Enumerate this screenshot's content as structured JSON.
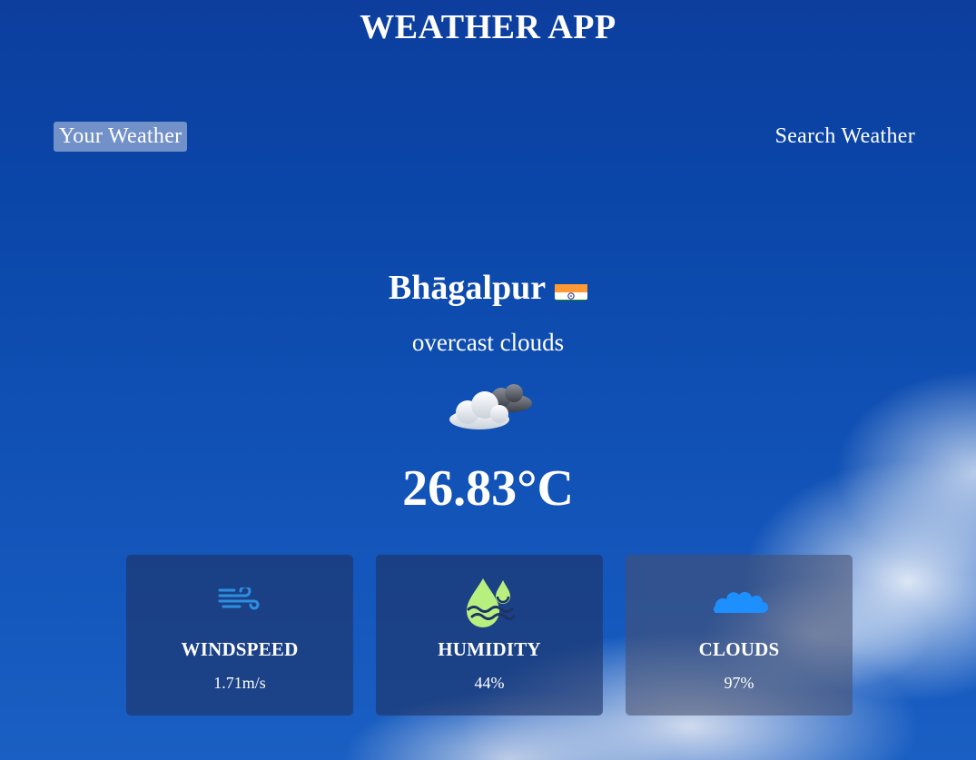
{
  "header": {
    "title": "WEATHER APP"
  },
  "tabs": [
    {
      "label": "Your Weather",
      "active": true
    },
    {
      "label": "Search Weather",
      "active": false
    }
  ],
  "weather": {
    "city": "Bhāgalpur",
    "country_flag_icon": "india-flag-icon",
    "description": "overcast clouds",
    "condition_icon": "overcast-clouds-icon",
    "temperature": "26.83°C"
  },
  "stats": [
    {
      "icon": "wind-icon",
      "label": "WINDSPEED",
      "value": "1.71m/s"
    },
    {
      "icon": "humidity-drops-icon",
      "label": "HUMIDITY",
      "value": "44%"
    },
    {
      "icon": "cloud-icon",
      "label": "CLOUDS",
      "value": "97%"
    }
  ],
  "colors": {
    "sky_blue": "#0a46a8",
    "card_bg": "#1e3264",
    "wind_icon": "#2e8fe0",
    "humidity_icon": "#b8f080",
    "cloud_icon": "#1e8fff"
  }
}
